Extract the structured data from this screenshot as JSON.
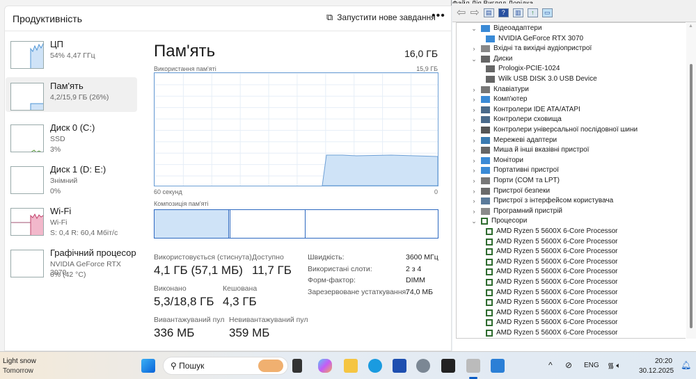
{
  "taskmanager": {
    "title": "Продуктивність",
    "new_task": "Запустити нове завдання",
    "more": "•••",
    "sidebar": [
      {
        "name": "ЦП",
        "sub1": "54%  4,47 ГГц",
        "sub2": ""
      },
      {
        "name": "Пам'ять",
        "sub1": "4,2/15,9 ГБ (26%)",
        "sub2": ""
      },
      {
        "name": "Диск 0 (C:)",
        "sub1": "SSD",
        "sub2": "3%"
      },
      {
        "name": "Диск 1 (D: E:)",
        "sub1": "Знімний",
        "sub2": "0%"
      },
      {
        "name": "Wi-Fi",
        "sub1": "Wi-Fi",
        "sub2": "S: 0,4  R: 60,4 Мбіт/с"
      },
      {
        "name": "Графічний процесор",
        "sub1": "NVIDIA GeForce RTX 3070",
        "sub2": "0%  (42 °C)"
      }
    ],
    "main": {
      "title": "Пам'ять",
      "total": "16,0 ГБ",
      "usage_label": "Використання пам'яті",
      "usage_max": "15,9 ГБ",
      "time_label": "60 секунд",
      "zero": "0",
      "composition_label": "Композиція пам'яті",
      "usage_fraction": 0.26,
      "stats": [
        {
          "label": "Використовується (стиснута)",
          "value": "4,1 ГБ (57,1 МБ)"
        },
        {
          "label": "Доступно",
          "value": "11,7 ГБ"
        },
        {
          "label": "Виконано",
          "value": "5,3/18,8 ГБ"
        },
        {
          "label": "Кешована",
          "value": "4,3 ГБ"
        },
        {
          "label": "Вивантажуваний пул",
          "value": "336 МБ"
        },
        {
          "label": "Невивантажуваний пул",
          "value": "359 МБ"
        }
      ],
      "props": [
        {
          "k": "Швидкість:",
          "v": "3600 МГц"
        },
        {
          "k": "Використані слоти:",
          "v": "2 з 4"
        },
        {
          "k": "Форм-фактор:",
          "v": "DIMM"
        },
        {
          "k": "Зарезервоване устаткування:",
          "v": "74,0 МБ"
        }
      ]
    }
  },
  "devmgr": {
    "menu": "Файл   Дія   Вигляд   Довідка",
    "tree": [
      {
        "t": "Відеоадаптери",
        "l": 0,
        "c": "v",
        "i": "monitor"
      },
      {
        "t": "NVIDIA GeForce RTX 3070",
        "l": 1,
        "i": "monitor"
      },
      {
        "t": "Вхідні та вихідні аудіопристрої",
        "l": 0,
        "c": ">",
        "i": "speaker"
      },
      {
        "t": "Диски",
        "l": 0,
        "c": "v",
        "i": "disk"
      },
      {
        "t": "Prologix-PCIE-1024",
        "l": 1,
        "i": "disk"
      },
      {
        "t": "Wilk USB DISK 3.0 USB Device",
        "l": 1,
        "i": "disk"
      },
      {
        "t": "Клавіатури",
        "l": 0,
        "c": ">",
        "i": "keyboard"
      },
      {
        "t": "Комп'ютер",
        "l": 0,
        "c": ">",
        "i": "monitor"
      },
      {
        "t": "Контролери IDE ATA/ATAPI",
        "l": 0,
        "c": ">",
        "i": "controller"
      },
      {
        "t": "Контролери сховища",
        "l": 0,
        "c": ">",
        "i": "controller"
      },
      {
        "t": "Контролери універсальної послідовної шини",
        "l": 0,
        "c": ">",
        "i": "usb"
      },
      {
        "t": "Мережеві адаптери",
        "l": 0,
        "c": ">",
        "i": "network"
      },
      {
        "t": "Миша й інші вказівні пристрої",
        "l": 0,
        "c": ">",
        "i": "mouse"
      },
      {
        "t": "Монітори",
        "l": 0,
        "c": ">",
        "i": "monitor"
      },
      {
        "t": "Портативні пристрої",
        "l": 0,
        "c": ">",
        "i": "monitor"
      },
      {
        "t": "Порти (COM та LPT)",
        "l": 0,
        "c": ">",
        "i": "port"
      },
      {
        "t": "Пристрої безпеки",
        "l": 0,
        "c": ">",
        "i": "security"
      },
      {
        "t": "Пристрої з інтерфейсом користувача",
        "l": 0,
        "c": ">",
        "i": "hid"
      },
      {
        "t": "Програмний пристрій",
        "l": 0,
        "c": ">",
        "i": "software"
      },
      {
        "t": "Процесори",
        "l": 0,
        "c": "v",
        "i": "cpu"
      },
      {
        "t": "AMD Ryzen 5 5600X 6-Core Processor",
        "l": 1,
        "i": "cpu"
      },
      {
        "t": "AMD Ryzen 5 5600X 6-Core Processor",
        "l": 1,
        "i": "cpu"
      },
      {
        "t": "AMD Ryzen 5 5600X 6-Core Processor",
        "l": 1,
        "i": "cpu"
      },
      {
        "t": "AMD Ryzen 5 5600X 6-Core Processor",
        "l": 1,
        "i": "cpu"
      },
      {
        "t": "AMD Ryzen 5 5600X 6-Core Processor",
        "l": 1,
        "i": "cpu"
      },
      {
        "t": "AMD Ryzen 5 5600X 6-Core Processor",
        "l": 1,
        "i": "cpu"
      },
      {
        "t": "AMD Ryzen 5 5600X 6-Core Processor",
        "l": 1,
        "i": "cpu"
      },
      {
        "t": "AMD Ryzen 5 5600X 6-Core Processor",
        "l": 1,
        "i": "cpu"
      },
      {
        "t": "AMD Ryzen 5 5600X 6-Core Processor",
        "l": 1,
        "i": "cpu"
      },
      {
        "t": "AMD Ryzen 5 5600X 6-Core Processor",
        "l": 1,
        "i": "cpu"
      },
      {
        "t": "AMD Ryzen 5 5600X 6-Core Processor",
        "l": 1,
        "i": "cpu"
      }
    ]
  },
  "taskbar": {
    "weather1": "Light snow",
    "weather2": "Tomorrow",
    "search": "Пошук",
    "lang": "ENG",
    "time": "20:20",
    "date": "30.12.2025"
  },
  "colors": {
    "accent": "#0a5bc4",
    "mem_fill": "#cfe3f7",
    "mem_line": "#6ea0d6",
    "wifi": "#f2b8cb"
  }
}
